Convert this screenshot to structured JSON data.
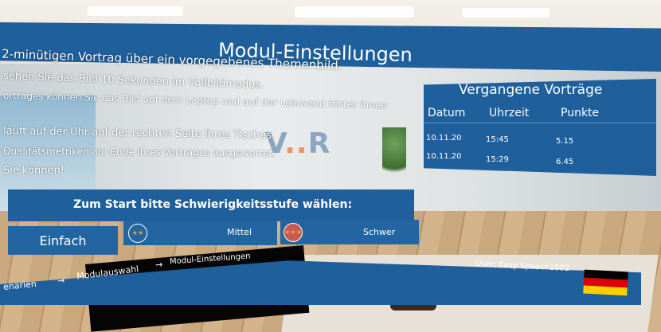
{
  "title": "Modul-Einstellungen",
  "info_lines": [
    "2-minütigen Vortrag über ein vorgegebenes Themenbild.",
    "sehen Sie das Bild 10 Sekunden im Vollbildmodus.",
    "ortrages können Sie das Bild auf dem Laptop und auf der Leinwand hinter Ihnen",
    "läuft auf der Uhr auf der rechten Seite Ihres Tisches.",
    "Qualitätsmetriken am Ende Ihres Vortrages ausgewertet.",
    "Sie können!"
  ],
  "logo": {
    "text_v": "V",
    "text_dots": "..",
    "text_r": "R"
  },
  "history": {
    "title": "Vergangene Vorträge",
    "columns": [
      "Datum",
      "Uhrzeit",
      "Punkte"
    ],
    "rows": [
      {
        "datum": "10.11.20",
        "uhrzeit": "15:45",
        "punkte": "5.15"
      },
      {
        "datum": "10.11.20",
        "uhrzeit": "15:29",
        "punkte": "6.45"
      }
    ]
  },
  "difficulty": {
    "prompt": "Zum Start bitte Schwierigkeitsstufe wählen:",
    "options": [
      "Einfach",
      "Mittel",
      "Schwer"
    ]
  },
  "breadcrumb": {
    "items": [
      "enarien",
      "Modulauswahl",
      "Modul-Einstellungen"
    ],
    "separator": "→"
  },
  "user": {
    "label": "User: Easy Speech1002"
  },
  "colors": {
    "panel": "#1f5f9c",
    "flag": [
      "#000000",
      "#dd0000",
      "#ffce00"
    ]
  }
}
